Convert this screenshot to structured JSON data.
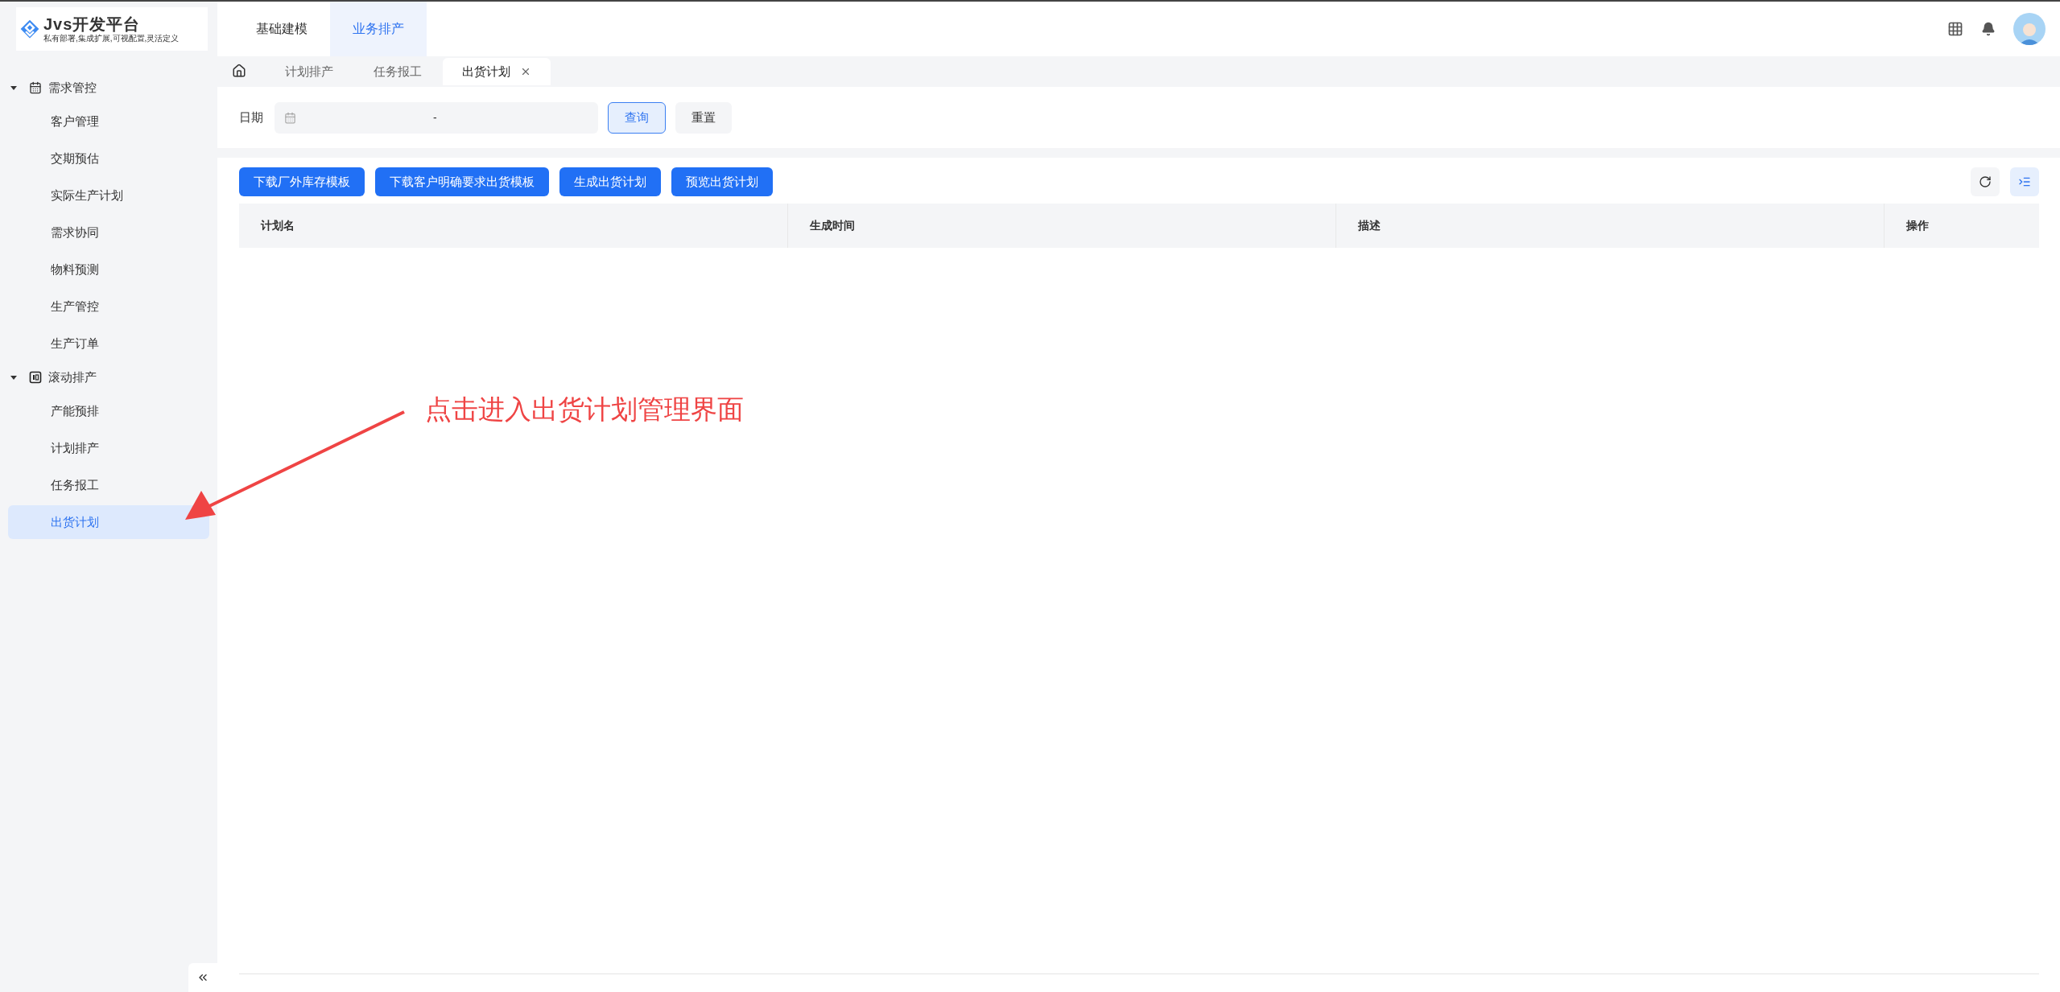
{
  "logo": {
    "title": "Jvs开发平台",
    "subtitle": "私有部署,集成扩展,可视配置,灵活定义"
  },
  "top_nav": [
    {
      "label": "基础建模",
      "selected": false
    },
    {
      "label": "业务排产",
      "selected": true
    }
  ],
  "page_tabs": [
    {
      "label": "计划排产",
      "selected": false,
      "closable": false
    },
    {
      "label": "任务报工",
      "selected": false,
      "closable": false
    },
    {
      "label": "出货计划",
      "selected": true,
      "closable": true
    }
  ],
  "sidebar": {
    "groups": [
      {
        "label": "需求管控",
        "expanded": true,
        "children": [
          {
            "label": "客户管理",
            "selected": false
          },
          {
            "label": "交期预估",
            "selected": false
          },
          {
            "label": "实际生产计划",
            "selected": false
          },
          {
            "label": "需求协同",
            "selected": false
          },
          {
            "label": "物料预测",
            "selected": false
          },
          {
            "label": "生产管控",
            "selected": false
          },
          {
            "label": "生产订单",
            "selected": false
          }
        ]
      },
      {
        "label": "滚动排产",
        "expanded": true,
        "children": [
          {
            "label": "产能预排",
            "selected": false
          },
          {
            "label": "计划排产",
            "selected": false
          },
          {
            "label": "任务报工",
            "selected": false
          },
          {
            "label": "出货计划",
            "selected": true
          }
        ]
      }
    ]
  },
  "filter": {
    "label": "日期",
    "range_separator": "-",
    "buttons": [
      {
        "label": "查询",
        "kind": "primary"
      },
      {
        "label": "重置",
        "kind": "default"
      }
    ]
  },
  "actions": [
    "下载厂外库存模板",
    "下载客户明确要求出货模板",
    "生成出货计划",
    "预览出货计划"
  ],
  "table": {
    "columns": [
      "计划名",
      "生成时间",
      "描述",
      "操作"
    ]
  },
  "annotation": {
    "text": "点击进入出货计划管理界面"
  }
}
